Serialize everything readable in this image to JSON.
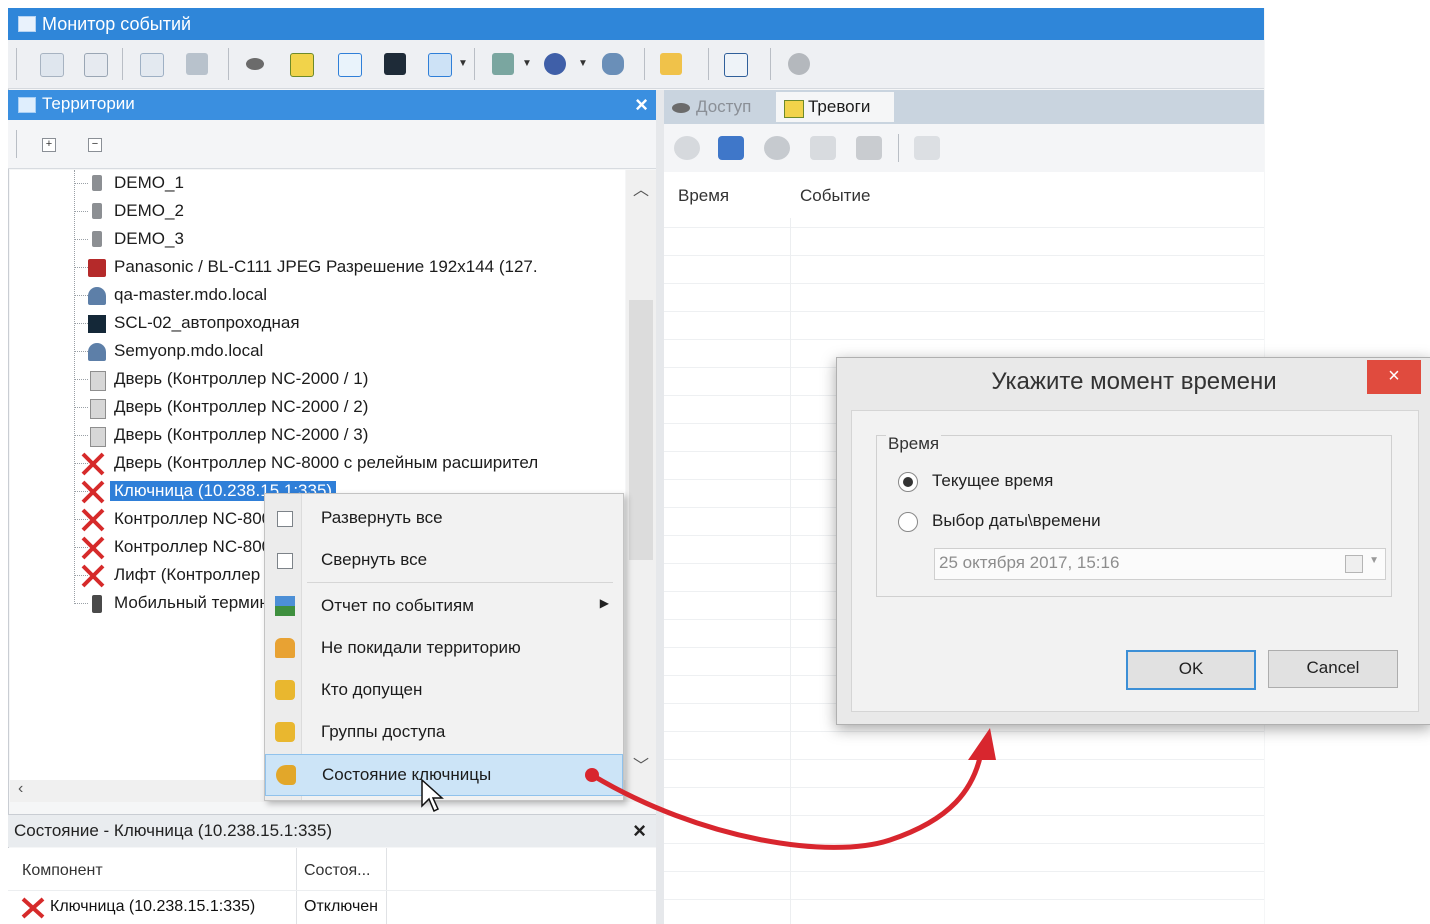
{
  "window": {
    "title": "Монитор событий"
  },
  "left_panel": {
    "title": "Территории",
    "tree": [
      {
        "label": "DEMO_1",
        "icon": "device-icon"
      },
      {
        "label": "DEMO_2",
        "icon": "device-icon"
      },
      {
        "label": "DEMO_3",
        "icon": "device-icon"
      },
      {
        "label": "Panasonic / BL-C111 JPEG Разрешение 192x144 (127.",
        "icon": "camera-error-icon"
      },
      {
        "label": "qa-master.mdo.local",
        "icon": "computer-icon"
      },
      {
        "label": "SCL-02_автопроходная",
        "icon": "monitor-icon"
      },
      {
        "label": "Semyonp.mdo.local",
        "icon": "computer-icon"
      },
      {
        "label": "Дверь (Контроллер NC-2000 / 1)",
        "icon": "door-icon"
      },
      {
        "label": "Дверь (Контроллер NC-2000 / 2)",
        "icon": "door-icon"
      },
      {
        "label": "Дверь (Контроллер NC-2000 / 3)",
        "icon": "door-icon"
      },
      {
        "label": "Дверь (Контроллер NC-8000 с релейным расширител",
        "icon": "error-icon"
      },
      {
        "label": "Ключница (10.238.15.1:335)",
        "icon": "error-icon",
        "selected": true
      },
      {
        "label": "Контроллер NC-8000",
        "icon": "error-icon"
      },
      {
        "label": "Контроллер NC-8000",
        "icon": "error-icon"
      },
      {
        "label": "Лифт (Контроллер",
        "icon": "error-icon"
      },
      {
        "label": "Мобильный терминал",
        "icon": "mobile-icon"
      }
    ]
  },
  "context_menu": {
    "items": [
      {
        "label": "Развернуть все",
        "icon": "expand-icon"
      },
      {
        "label": "Свернуть все",
        "icon": "collapse-icon"
      },
      {
        "label": "Отчет по событиям",
        "icon": "report-icon",
        "submenu": true
      },
      {
        "label": "Не покидали территорию",
        "icon": "people-icon"
      },
      {
        "label": "Кто допущен",
        "icon": "lock-icon"
      },
      {
        "label": "Группы доступа",
        "icon": "lock-icon"
      },
      {
        "label": "Состояние ключницы",
        "icon": "key-icon",
        "highlighted": true
      }
    ]
  },
  "state_panel": {
    "title": "Состояние - Ключница (10.238.15.1:335)",
    "columns": [
      "Компонент",
      "Состоя..."
    ],
    "rows": [
      {
        "component": "Ключница (10.238.15.1:335)",
        "state": "Отключен"
      }
    ]
  },
  "right_panel": {
    "tabs": [
      {
        "label": "Доступ",
        "active": false
      },
      {
        "label": "Тревоги",
        "active": true
      }
    ],
    "columns": [
      "Время",
      "Событие"
    ]
  },
  "dialog": {
    "title": "Укажите момент времени",
    "close_label": "×",
    "group_label": "Время",
    "option_current": "Текущее время",
    "option_pick": "Выбор даты\\времени",
    "selected_option": "current",
    "datetime_value": "25 октября 2017, 15:16",
    "ok_label": "OK",
    "cancel_label": "Cancel"
  },
  "colors": {
    "titlebar": "#2f86d9",
    "selection": "#2f7fd8",
    "menu_highlight": "#cce4f7",
    "dialog_close": "#e04b3e",
    "annotation_arrow": "#d8262e"
  }
}
